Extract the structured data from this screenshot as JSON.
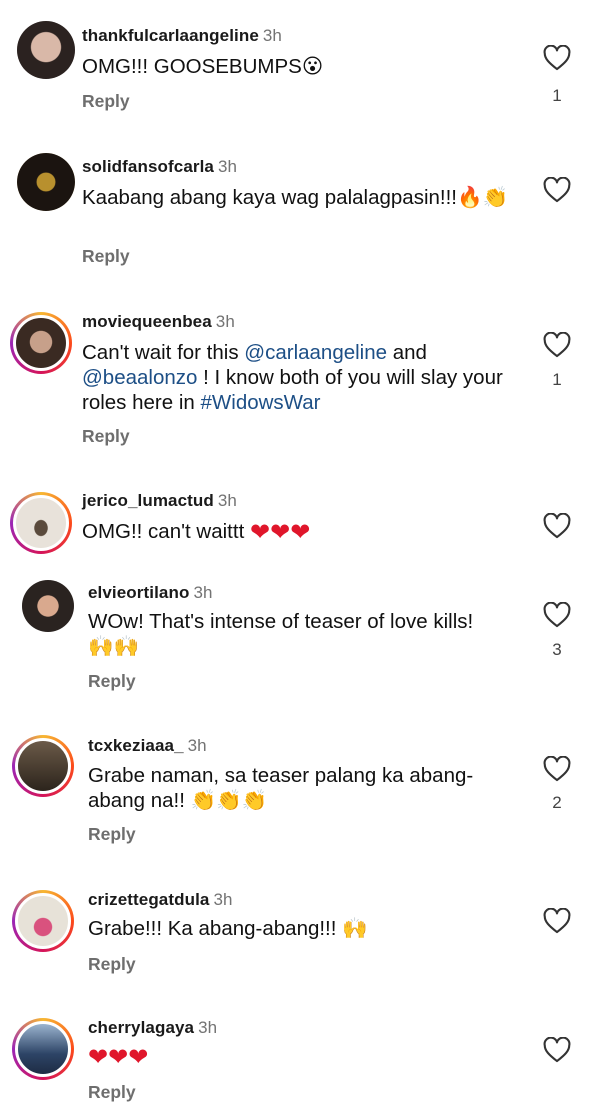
{
  "comments": [
    {
      "username": "thankfulcarlaangeline",
      "time": "3h",
      "text": "OMG!!! GOOSEBUMPS",
      "emoji": "😮",
      "reply_label": "Reply",
      "likes": "1",
      "avatar_ring": false,
      "avatar_colors": [
        "#2b2220",
        "#d9b8a8"
      ]
    },
    {
      "username": "solidfansofcarla",
      "time": "3h",
      "text": "Kaabang abang kaya wag palalagpasin!!!",
      "emoji": "🔥👏",
      "reply_label": "Reply",
      "likes": "",
      "avatar_ring": false,
      "avatar_colors": [
        "#1b1410",
        "#b8902e"
      ]
    },
    {
      "username": "moviequeenbea",
      "time": "3h",
      "text_parts": [
        "Can't wait for this ",
        "@carlaangeline",
        " and ",
        "@beaalonzo",
        " ! I know both of you will slay your roles here in ",
        "#WidowsWar"
      ],
      "reply_label": "Reply",
      "likes": "1",
      "avatar_ring": true,
      "avatar_colors": [
        "#3a2a22",
        "#c7a08a"
      ]
    },
    {
      "username": "jerico_lumactud",
      "time": "3h",
      "text": "OMG!! can't waittt",
      "emoji": "❤❤❤",
      "reply_label": "",
      "likes": "",
      "avatar_ring": true,
      "avatar_colors": [
        "#e8e2da",
        "#5a4a3c"
      ]
    },
    {
      "username": "elvieortilano",
      "time": "3h",
      "text": "WOw! That's intense of teaser of love kills!",
      "emoji": "🙌🙌",
      "reply_label": "Reply",
      "likes": "3",
      "avatar_ring": false,
      "avatar_colors": [
        "#2a2320",
        "#d9a98e"
      ]
    },
    {
      "username": "tcxkeziaaa_",
      "time": "3h",
      "text": "Grabe naman, sa teaser palang ka abang-abang na!!",
      "emoji": "👏👏👏",
      "reply_label": "Reply",
      "likes": "2",
      "avatar_ring": true,
      "avatar_colors": [
        "#6b5a48",
        "#2c241c"
      ]
    },
    {
      "username": "crizettegatdula",
      "time": "3h",
      "text": "Grabe!!! Ka abang-abang!!!",
      "emoji": "🙌",
      "reply_label": "Reply",
      "likes": "",
      "avatar_ring": true,
      "avatar_colors": [
        "#e7e2d8",
        "#d9527e"
      ]
    },
    {
      "username": "cherrylagaya",
      "time": "3h",
      "text": "",
      "emoji": "❤❤❤",
      "reply_label": "Reply",
      "likes": "",
      "avatar_ring": true,
      "avatar_colors": [
        "#2d4466",
        "#9bb4cf"
      ]
    }
  ],
  "icons": {
    "like": "heart-outline-icon"
  },
  "colors": {
    "mention": "#1d4f86",
    "heart": "#e0162b",
    "meta": "#737373"
  }
}
